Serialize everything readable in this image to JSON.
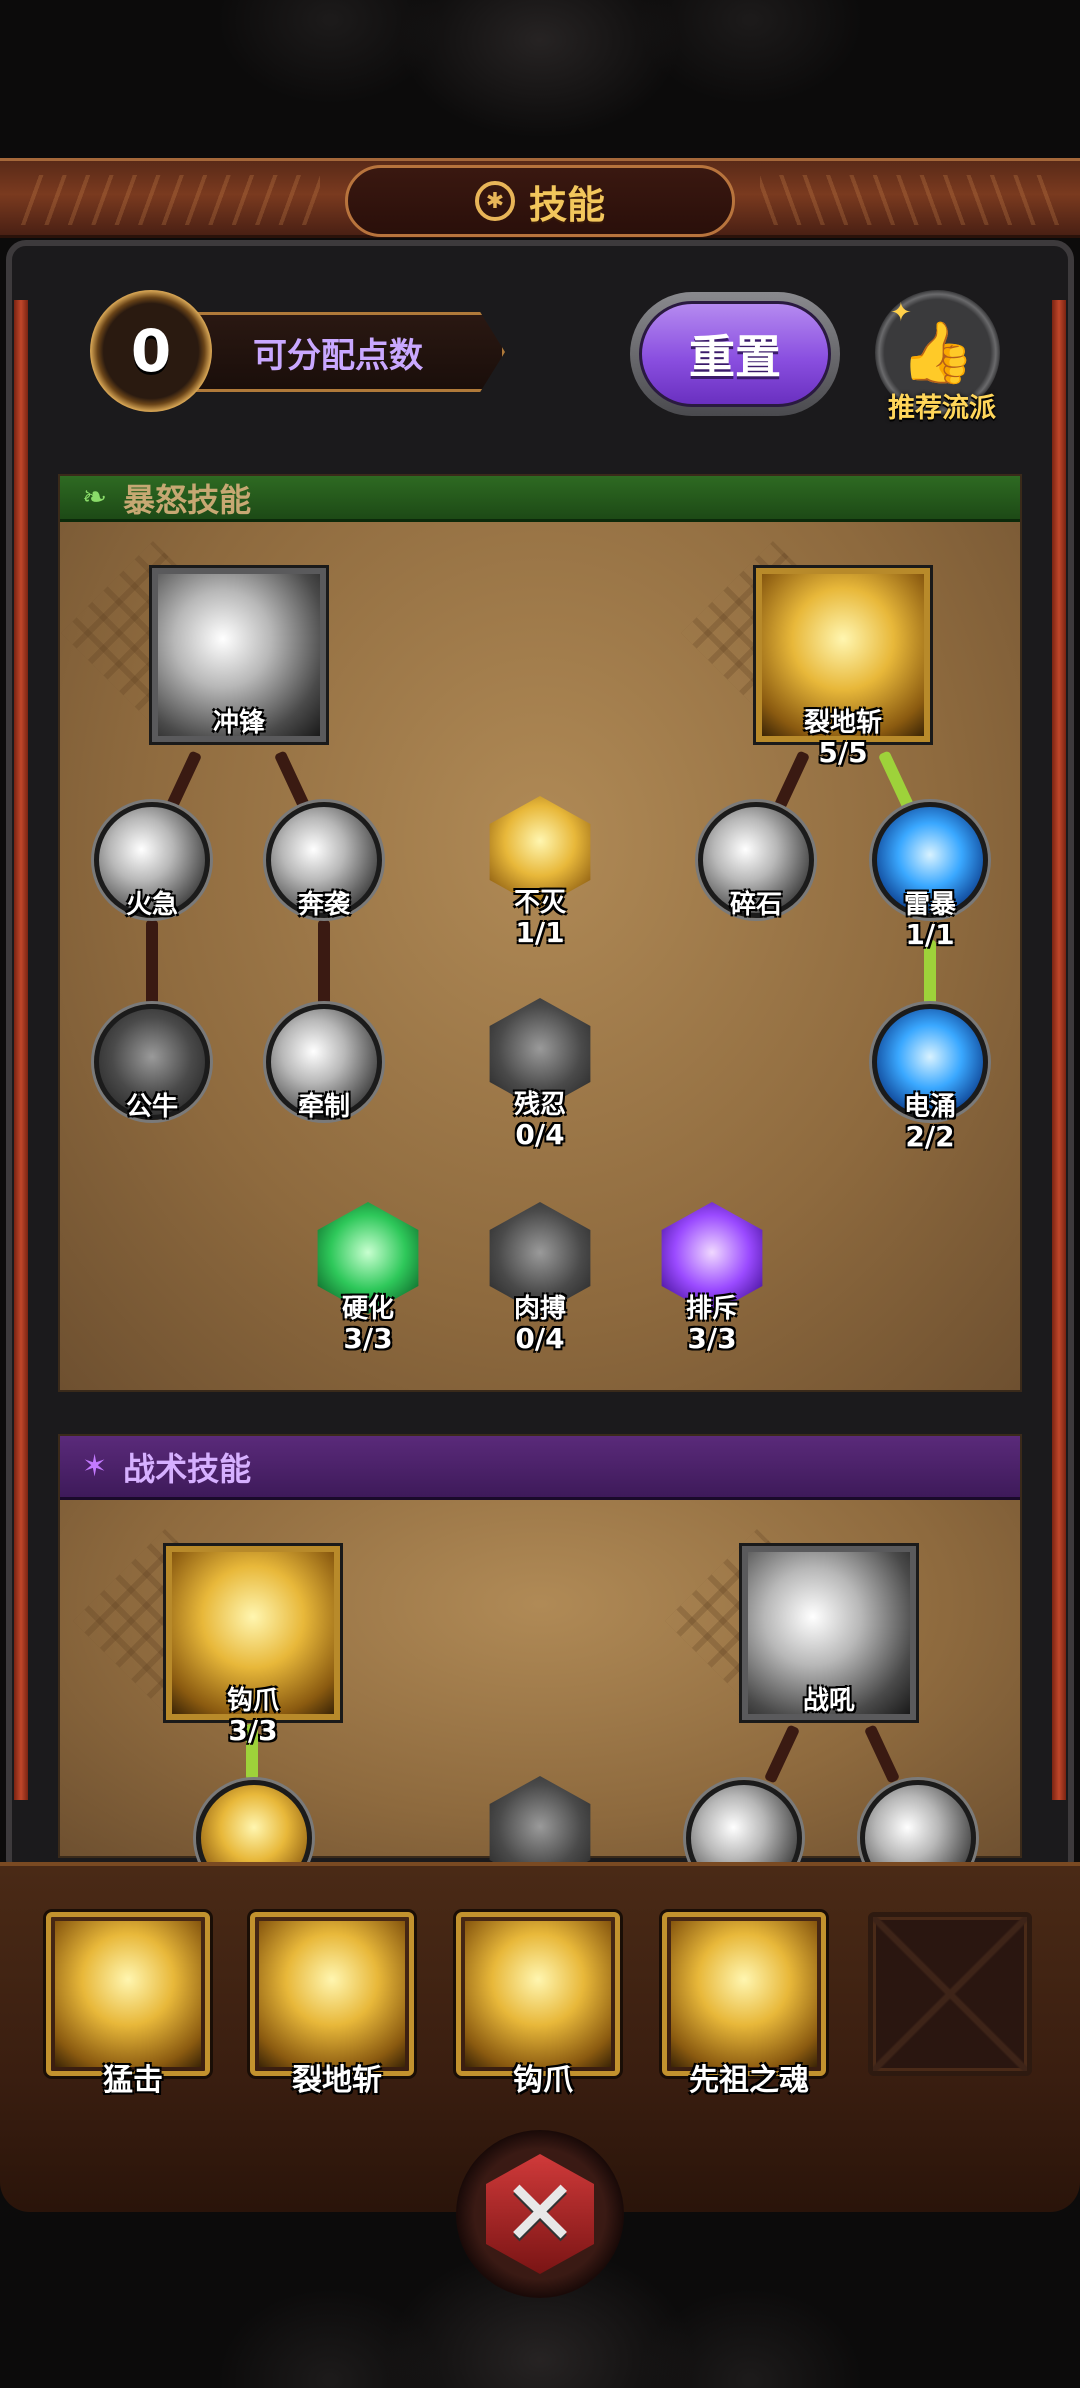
{
  "header": {
    "title": "技能"
  },
  "points": {
    "value": "0",
    "label": "可分配点数"
  },
  "buttons": {
    "reset": "重置",
    "recommend": "推荐流派"
  },
  "sections": {
    "rage": "暴怒技能",
    "tactic": "战术技能"
  },
  "rage_nodes": {
    "charge": {
      "name": "冲锋"
    },
    "earthsplit": {
      "name": "裂地斩",
      "level": "5/5"
    },
    "rush": {
      "name": "火急"
    },
    "assault": {
      "name": "奔袭"
    },
    "immortal": {
      "name": "不灭",
      "level": "1/1"
    },
    "gravel": {
      "name": "碎石"
    },
    "thunderstorm": {
      "name": "雷暴",
      "level": "1/1"
    },
    "bull": {
      "name": "公牛"
    },
    "restrain": {
      "name": "牵制"
    },
    "cruel": {
      "name": "残忍",
      "level": "0/4"
    },
    "surge": {
      "name": "电涌",
      "level": "2/2"
    },
    "harden": {
      "name": "硬化",
      "level": "3/3"
    },
    "melee": {
      "name": "肉搏",
      "level": "0/4"
    },
    "repel": {
      "name": "排斥",
      "level": "3/3"
    }
  },
  "tactic_nodes": {
    "hookclaw": {
      "name": "钩爪",
      "level": "3/3"
    },
    "warcry": {
      "name": "战吼"
    }
  },
  "slots": [
    {
      "name": "猛击",
      "color": "#f0b830"
    },
    {
      "name": "裂地斩",
      "color": "#e8c048"
    },
    {
      "name": "钩爪",
      "color": "#e8a830"
    },
    {
      "name": "先祖之魂",
      "color": "#d8982a"
    }
  ]
}
